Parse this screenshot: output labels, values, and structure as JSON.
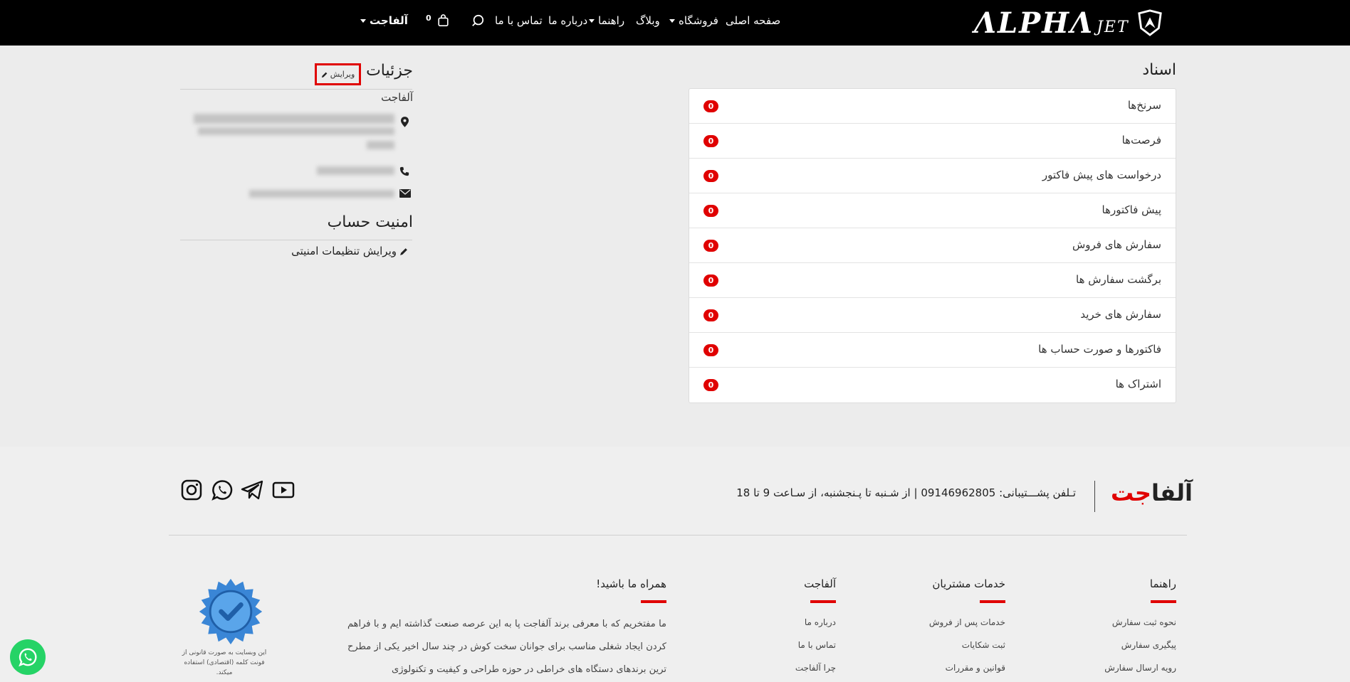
{
  "header": {
    "logo_word": "ΛLPHΛ",
    "logo_suffix": "JET",
    "nav": {
      "home": "صفحه اصلی",
      "shop": "فروشگاه",
      "blog": "وبلاگ",
      "guides": "راهنما",
      "about": "درباره ما",
      "contact": "تماس با ما",
      "account": "آلفاجت"
    },
    "cart_count": "0"
  },
  "details": {
    "title": "جزئیات",
    "edit_label": "ویرایش",
    "company": "آلفاجت"
  },
  "security": {
    "title": "امنیت حساب",
    "edit_link": "ویرایش تنظیمات امنیتی"
  },
  "documents": {
    "title": "اسناد",
    "items": [
      {
        "label": "سرنخ‌ها",
        "count": "0"
      },
      {
        "label": "فرصت‌ها",
        "count": "0"
      },
      {
        "label": "درخواست های پیش فاکتور",
        "count": "0"
      },
      {
        "label": "پیش فاکتورها",
        "count": "0"
      },
      {
        "label": "سفارش های فروش",
        "count": "0"
      },
      {
        "label": "برگشت سفارش ها",
        "count": "0"
      },
      {
        "label": "سفارش های خرید",
        "count": "0"
      },
      {
        "label": "فاکتورها و صورت حساب ها",
        "count": "0"
      },
      {
        "label": "اشتراک ها",
        "count": "0"
      }
    ]
  },
  "footer": {
    "brand_part1": "آلفا",
    "brand_part2": "جت",
    "support": "تـلفن پشـــتیبانی: 09146962805  |  از شـنبه تا پـنجشنبه، از سـاعت 9 تا 18",
    "columns": {
      "guide": {
        "title": "راهنما",
        "links": [
          "نحوه ثبت سفارش",
          "پیگیری سفارش",
          "رویه ارسال سفارش"
        ]
      },
      "customer": {
        "title": "خدمات مشتریان",
        "links": [
          "خدمات پس از فروش",
          "ثبت شکایات",
          "قوانین و مقررات"
        ]
      },
      "alphajet": {
        "title": "آلفاجت",
        "links": [
          "درباره ما",
          "تماس با ما",
          "چرا آلفاجت"
        ]
      },
      "join": {
        "title": "همراه ما باشید!",
        "text": "ما مفتخریم که با معرفی برند آلفاجت پا به این عرصه صنعت گذاشته ایم و با فراهم کردن ایجاد شغلی مناسب برای جوانان سخت کوش در چند سال اخیر یکی از مطرح ترین برندهای دستگاه های خراطی در حوزه طراحی و کیفیت و تکنولوژی"
      }
    },
    "seal_note": "این وبسایت به صورت قانونی از فونت کلمه (اقتصادی) استفاده میکند.",
    "colors": {
      "accent": "#e00000",
      "whatsapp": "#25d366"
    }
  }
}
